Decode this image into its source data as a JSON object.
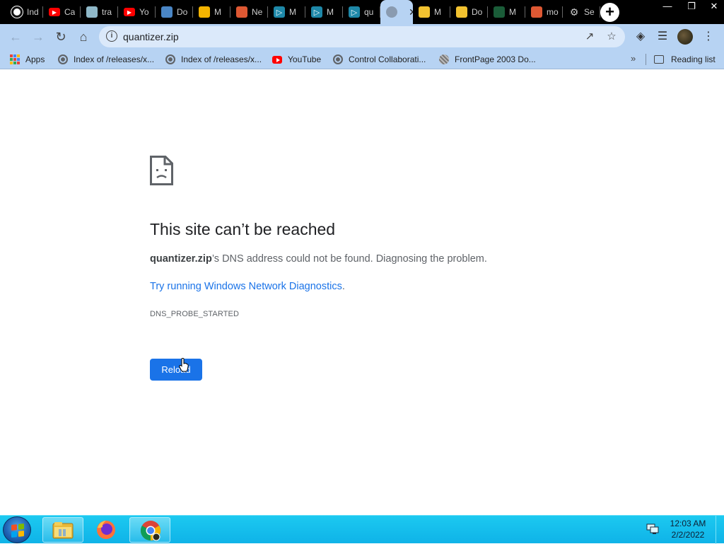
{
  "tabs": [
    {
      "label": "Ind",
      "icon": "github-icon",
      "color": "#ffffff"
    },
    {
      "label": "Ca",
      "icon": "youtube-icon",
      "color": "#ff0000"
    },
    {
      "label": "tra",
      "icon": "upload-icon",
      "color": "#8fb8c8"
    },
    {
      "label": "Yo",
      "icon": "youtube-icon",
      "color": "#ff0000"
    },
    {
      "label": "Do",
      "icon": "doc-icon",
      "color": "#4a86c5"
    },
    {
      "label": "M",
      "icon": "drive-icon",
      "color": "#f4b400"
    },
    {
      "label": "Ne",
      "icon": "duckduckgo-icon",
      "color": "#de5833"
    },
    {
      "label": "M",
      "icon": "play-icon",
      "color": "#1e88a8"
    },
    {
      "label": "M",
      "icon": "play-icon",
      "color": "#1e88a8"
    },
    {
      "label": "qu",
      "icon": "play-icon",
      "color": "#1e88a8"
    },
    {
      "label": "",
      "icon": "globe-icon",
      "color": "#5f6368",
      "active": true
    },
    {
      "label": "M",
      "icon": "python-icon",
      "color": "#f2c230"
    },
    {
      "label": "Do",
      "icon": "python-icon",
      "color": "#f2c230"
    },
    {
      "label": "M",
      "icon": "nvidia-icon",
      "color": "#1a5c38"
    },
    {
      "label": "mo",
      "icon": "duckduckgo-icon",
      "color": "#de5833"
    },
    {
      "label": "Se",
      "icon": "gear-icon",
      "color": "#cccccc"
    }
  ],
  "toolbar": {
    "url": "quantizer.zip"
  },
  "bookmarks": {
    "items": [
      {
        "label": "Apps",
        "icon": "apps-grid-icon"
      },
      {
        "label": "Index of /releases/x...",
        "icon": "globe-icon"
      },
      {
        "label": "Index of /releases/x...",
        "icon": "globe-icon"
      },
      {
        "label": "YouTube",
        "icon": "youtube-icon"
      },
      {
        "label": "Control Collaborati...",
        "icon": "globe-icon"
      },
      {
        "label": "FrontPage 2003 Do...",
        "icon": "frontpage-icon"
      }
    ],
    "overflow": "»",
    "reading_list": "Reading list"
  },
  "error_page": {
    "title": "This site can’t be reached",
    "host": "quantizer.zip",
    "message_rest": "’s DNS address could not be found. Diagnosing the problem.",
    "link_text": "Try running Windows Network Diagnostics",
    "link_trail": ".",
    "error_code": "DNS_PROBE_STARTED",
    "reload_label": "Reload"
  },
  "taskbar": {
    "time": "12:03 AM",
    "date": "2/2/2022",
    "apps": [
      "file-explorer-icon",
      "firefox-icon",
      "chrome-icon"
    ]
  },
  "colors": {
    "chrome_frame": "#b7d3f3",
    "link_blue": "#1a73e8",
    "taskbar": "#1cc9f0"
  }
}
